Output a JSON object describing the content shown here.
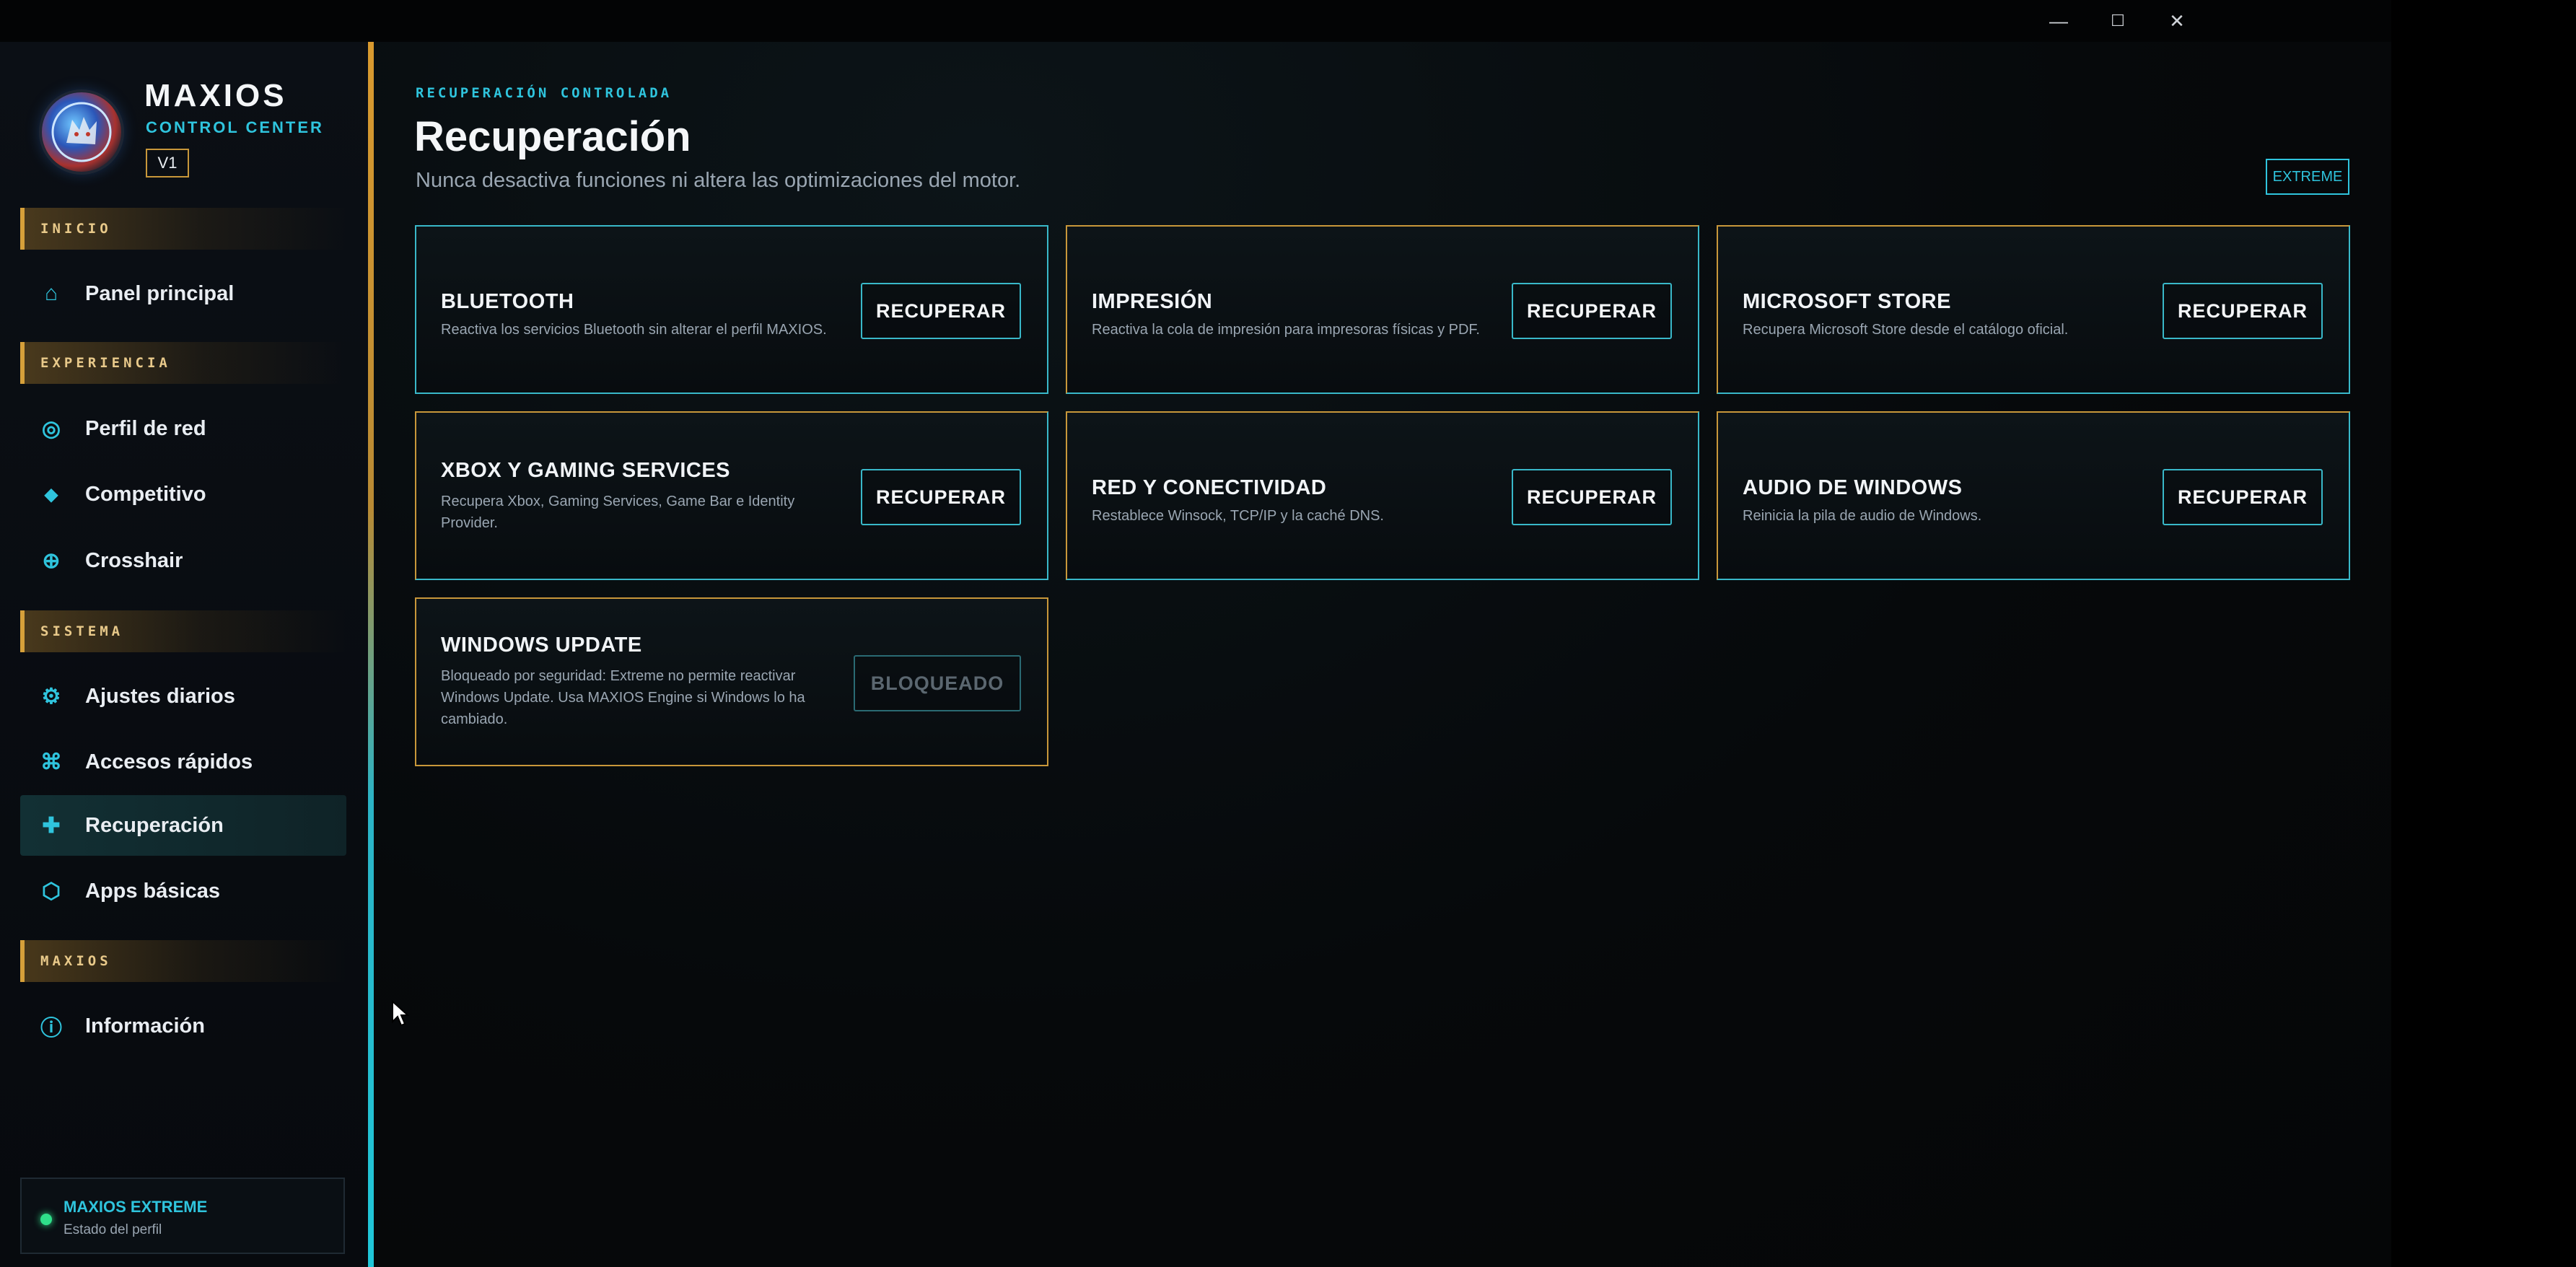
{
  "window": {
    "minimize_icon": "minimize-icon",
    "maximize_icon": "maximize-icon",
    "close_icon": "close-icon",
    "minimize_glyph": "—",
    "maximize_glyph": "☐",
    "close_glyph": "✕"
  },
  "brand": {
    "name": "MAXIOS",
    "subtitle": "CONTROL CENTER",
    "version": "V1"
  },
  "sidebar": {
    "sections": [
      {
        "label": "INICIO"
      },
      {
        "label": "EXPERIENCIA"
      },
      {
        "label": "SISTEMA"
      },
      {
        "label": "MAXIOS"
      }
    ],
    "items": [
      {
        "label": "Panel principal",
        "icon": "home-icon",
        "glyph": "⌂"
      },
      {
        "label": "Perfil de red",
        "icon": "target-icon",
        "glyph": "◎"
      },
      {
        "label": "Competitivo",
        "icon": "diamond-icon",
        "glyph": "◆"
      },
      {
        "label": "Crosshair",
        "icon": "crosshair-icon",
        "glyph": "⊕"
      },
      {
        "label": "Ajustes diarios",
        "icon": "gear-icon",
        "glyph": "⚙"
      },
      {
        "label": "Accesos rápidos",
        "icon": "command-icon",
        "glyph": "⌘"
      },
      {
        "label": "Recuperación",
        "icon": "plus-icon",
        "glyph": "✚",
        "active": true
      },
      {
        "label": "Apps básicas",
        "icon": "hexagon-icon",
        "glyph": "⬡"
      },
      {
        "label": "Información",
        "icon": "info-icon",
        "glyph": "ⓘ"
      }
    ],
    "status": {
      "title": "MAXIOS EXTREME",
      "subtitle": "Estado del perfil"
    }
  },
  "header": {
    "eyebrow": "RECUPERACIÓN CONTROLADA",
    "title": "Recuperación",
    "subtitle": "Nunca desactiva funciones ni altera las optimizaciones del motor.",
    "badge": "EXTREME"
  },
  "cards": [
    {
      "title": "BLUETOOTH",
      "description": "Reactiva los servicios Bluetooth sin alterar el perfil MAXIOS.",
      "button": "RECUPERAR"
    },
    {
      "title": "IMPRESIÓN",
      "description": "Reactiva la cola de impresión para impresoras físicas y PDF.",
      "button": "RECUPERAR"
    },
    {
      "title": "MICROSOFT STORE",
      "description": "Recupera Microsoft Store desde el catálogo oficial.",
      "button": "RECUPERAR"
    },
    {
      "title": "XBOX Y GAMING SERVICES",
      "description": "Recupera Xbox, Gaming Services, Game Bar e Identity Provider.",
      "button": "RECUPERAR"
    },
    {
      "title": "RED Y CONECTIVIDAD",
      "description": "Restablece Winsock, TCP/IP y la caché DNS.",
      "button": "RECUPERAR"
    },
    {
      "title": "AUDIO DE WINDOWS",
      "description": "Reinicia la pila de audio de Windows.",
      "button": "RECUPERAR"
    },
    {
      "title": "WINDOWS UPDATE",
      "description": "Bloqueado por seguridad: Extreme no permite reactivar Windows Update. Usa MAXIOS Engine si Windows lo ha cambiado.",
      "button": "BLOQUEADO"
    }
  ],
  "colors": {
    "accent_cyan": "#2fc4dd",
    "accent_gold": "#c8973a",
    "background": "#050608",
    "status_green": "#2fe08a"
  }
}
